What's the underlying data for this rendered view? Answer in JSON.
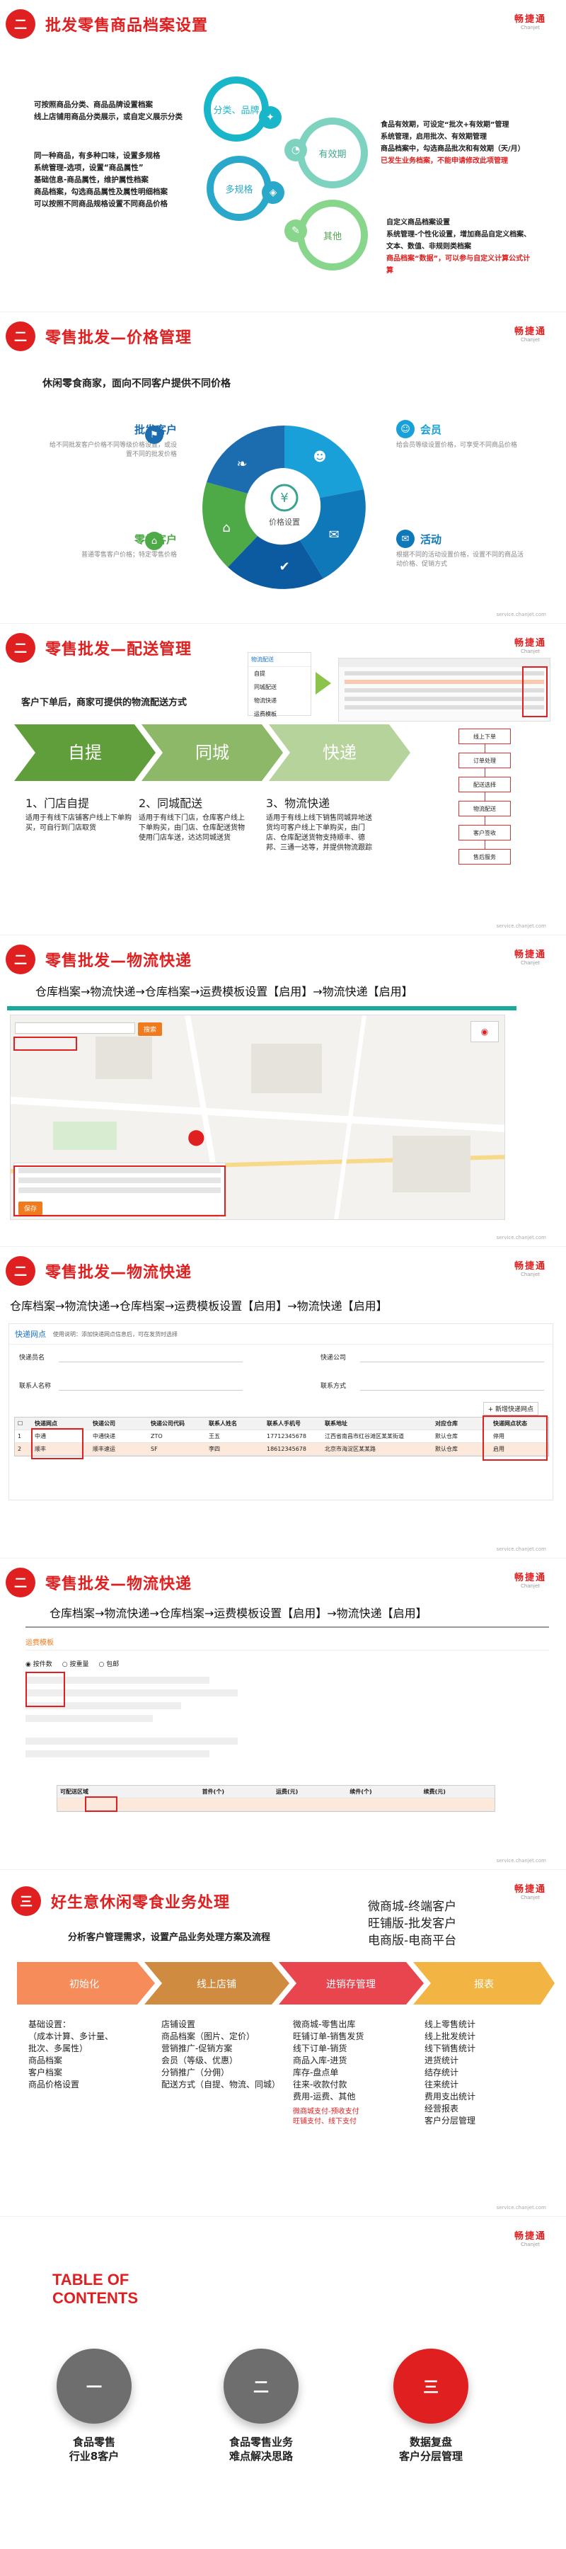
{
  "slide1": {
    "num": "二",
    "title": "批发零售商品档案设置",
    "logo": {
      "brand": "畅捷通",
      "sub": "Chanjet"
    },
    "left_lines": [
      "可按照商品分类、商品品牌设置档案",
      "线上店铺用商品分类展示，或自定义展示分类",
      "同一种商品，有多种口味，设置多规格",
      "系统管理-选项，设置“商品属性”",
      "基础信息-商品属性，维护属性档案",
      "商品档案，勾选商品属性及属性明细档案"
    ],
    "left_red": "可以按照不同商品规格设置不同商品价格",
    "petals": {
      "a": "分类、品牌",
      "b": "有效期",
      "c": "多规格",
      "d": "其他"
    },
    "right_top": [
      "食品有效期，可设定“批次+有效期”管理",
      "系统管理，启用批次、有效期管理",
      "商品档案中，勾选商品批次和有效期（天/月）"
    ],
    "right_top_red": "已发生业务档案，不能申请修改此项管理",
    "right_bottom": [
      "自定义商品档案设置",
      "系统管理-个性化设置，增加商品自定义档案、文本、数值、非规则类档案"
    ],
    "right_bottom_red": "商品档案“数据”，可以参与自定义计算公式计算"
  },
  "slide2": {
    "num": "二",
    "title": "零售批发—价格管理",
    "logo": {
      "brand": "畅捷通",
      "sub": "Chanjet"
    },
    "subtitle": "休闲零食商家，面向不同客户提供不同价格",
    "center": "价格设置",
    "items": {
      "wholesale": {
        "title": "批发客户",
        "desc": "给不同批发客户价格不同等级价格设置，或设置不同的批发价格"
      },
      "retail": {
        "title": "零售客户",
        "desc": "普通零售客户价格；特定零售价格"
      },
      "member": {
        "title": "会员",
        "desc": "给会员等级设置价格，可享受不同商品价格"
      },
      "promo": {
        "title": "活动",
        "desc": "根据不同的活动设置价格，设置不同的商品活动价格、促销方式"
      }
    },
    "url": "service.chanjet.com"
  },
  "slide3": {
    "num": "二",
    "title": "零售批发—配送管理",
    "logo": {
      "brand": "畅捷通",
      "sub": "Chanjet"
    },
    "subtitle": "客户下单后，商家可提供的物流配送方式",
    "menu": [
      "物流配送",
      "自提",
      "同城配送",
      "物流快递",
      "运费模板"
    ],
    "chevrons": [
      "自提",
      "同城",
      "快递"
    ],
    "methods": [
      {
        "title": "1、门店自提",
        "desc": "适用于有线下店铺客户线上下单购买，可自行到门店取货"
      },
      {
        "title": "2、同城配送",
        "desc": "适用于有线下门店，仓库客户线上下单购买，由门店、仓库配送货物使用门店车送，达达同城送货"
      },
      {
        "title": "3、物流快递",
        "desc": "适用于有线上线下销售同城异地送货均可客户线上下单购买，由门店、仓库配送货物支持顺丰、德邦、三通一达等，并提供物流跟踪"
      }
    ],
    "flow": [
      "线上下单",
      "订单处理",
      "配送选择",
      "物流配送",
      "客户签收",
      "售后服务"
    ],
    "url": "service.chanjet.com"
  },
  "slide4": {
    "num": "二",
    "title": "零售批发—物流快递",
    "logo": {
      "brand": "畅捷通",
      "sub": "Chanjet"
    },
    "path": "仓库档案→物流快递→仓库档案→运费模板设置【启用】→物流快递【启用】",
    "search_btn": "搜索",
    "save_btn": "保存",
    "url": "service.chanjet.com"
  },
  "slide5": {
    "num": "二",
    "title": "零售批发—物流快递",
    "logo": {
      "brand": "畅捷通",
      "sub": "Chanjet"
    },
    "path": "仓库档案→物流快递→仓库档案→运费模板设置【启用】→物流快递【启用】",
    "tab": "快递网点",
    "hint": "使用说明：添加快递网点信息后，可在发货时选择",
    "fields": [
      "快递员名",
      "快递公司",
      "联系人名称",
      "联系方式"
    ],
    "add_btn": "+ 新增快递网点",
    "headers": [
      "快递网点",
      "快递公司",
      "快递公司代码",
      "联系人姓名",
      "联系人手机号",
      "联系地址",
      "对应仓库",
      "快递网点状态"
    ],
    "rows": [
      [
        "中通",
        "中通快递",
        "ZTO",
        "王五",
        "17712345678",
        "江西省南昌市红谷滩区某某街道",
        "默认仓库",
        "停用"
      ],
      [
        "顺丰",
        "顺丰速运",
        "SF",
        "李四",
        "18612345678",
        "北京市海淀区某某路",
        "默认仓库",
        "启用"
      ]
    ],
    "url": "service.chanjet.com"
  },
  "slide6": {
    "num": "二",
    "title": "零售批发—物流快递",
    "logo": {
      "brand": "畅捷通",
      "sub": "Chanjet"
    },
    "path": "仓库档案→物流快递→仓库档案→运费模板设置【启用】→物流快递【启用】",
    "tmpl_title": "运费模板",
    "options": [
      "按件数",
      "按重量",
      "包邮"
    ],
    "headers": [
      "可配送区域",
      "首件(个)",
      "运费(元)",
      "续件(个)",
      "续费(元)"
    ],
    "url": "service.chanjet.com"
  },
  "slide7": {
    "num": "三",
    "title": "好生意休闲零食业务处理",
    "logo": {
      "brand": "畅捷通",
      "sub": "Chanjet"
    },
    "subtitle": "分析客户管理需求，设置产品业务处理方案及流程",
    "platforms": [
      "微商城-终端客户",
      "旺铺版-批发客户",
      "电商版-电商平台"
    ],
    "stages": [
      "初始化",
      "线上店铺",
      "进销存管理",
      "报表"
    ],
    "stage_colors": [
      "#f58c5a",
      "#cf8b3f",
      "#e8454f",
      "#f2b544"
    ],
    "cols": [
      [
        "基础设置：",
        "（成本计算、多计量、",
        "批次、多属性）",
        "商品档案",
        "客户档案",
        "商品价格设置"
      ],
      [
        "店铺设置",
        "商品档案（图片、定价）",
        "营销推广-促销方案",
        "会员（等级、优惠）",
        "分销推广（分佣）",
        "配送方式（自提、物流、同城）"
      ],
      [
        "微商城-零售出库",
        "旺铺订单-销售发货",
        "线下订单-销货",
        "商品入库-进货",
        "库存-盘点单",
        "往来-收款付款",
        "费用-运费、其他"
      ],
      [
        "线上零售统计",
        "线上批发统计",
        "线下销售统计",
        "进货统计",
        "结存统计",
        "往来统计",
        "费用支出统计",
        "经营报表",
        "客户分层管理"
      ]
    ],
    "col3_red": [
      "微商城支付-预收支付",
      "旺铺支付、线下支付"
    ],
    "url": "service.chanjet.com"
  },
  "slide8": {
    "logo": {
      "brand": "畅捷通",
      "sub": "Chanjet"
    },
    "toc_title": [
      "TABLE OF",
      "CONTENTS"
    ],
    "items": [
      {
        "num": "一",
        "label": [
          "食品零售",
          "行业8客户"
        ],
        "color": "#6e6e6e"
      },
      {
        "num": "二",
        "label": [
          "食品零售业务",
          "难点解决思路"
        ],
        "color": "#6e6e6e"
      },
      {
        "num": "三",
        "label": [
          "数据复盘",
          "客户分层管理"
        ],
        "color": "#e02020"
      }
    ]
  }
}
